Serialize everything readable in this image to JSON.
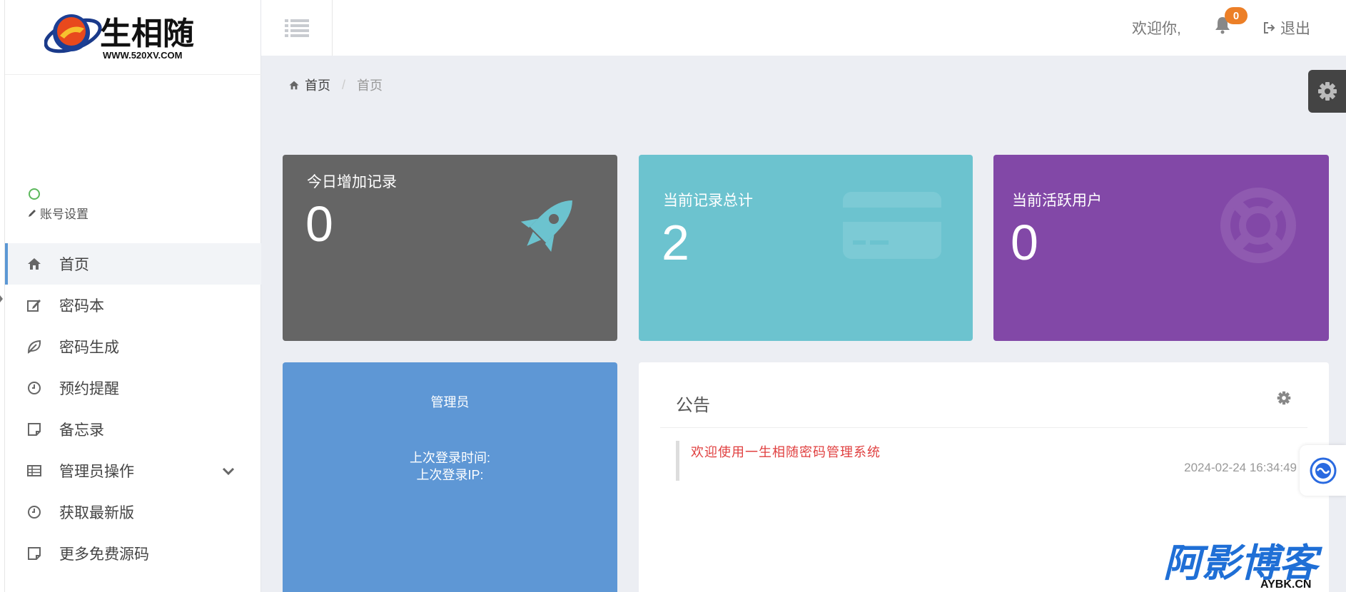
{
  "logo": {
    "text": "生相随",
    "url_text": "WWW.520XV.COM"
  },
  "sidebar": {
    "account_settings": "账号设置",
    "items": [
      {
        "label": "首页",
        "icon": "home-icon",
        "active": true
      },
      {
        "label": "密码本",
        "icon": "edit-icon"
      },
      {
        "label": "密码生成",
        "icon": "leaf-icon"
      },
      {
        "label": "预约提醒",
        "icon": "clock-icon"
      },
      {
        "label": "备忘录",
        "icon": "note-icon"
      },
      {
        "label": "管理员操作",
        "icon": "table-icon",
        "has_submenu": true
      },
      {
        "label": "获取最新版",
        "icon": "clock-icon"
      },
      {
        "label": "更多免费源码",
        "icon": "note-icon"
      }
    ]
  },
  "topbar": {
    "welcome": "欢迎你,",
    "notification_count": "0",
    "logout": "退出"
  },
  "breadcrumb": {
    "home": "首页",
    "current": "首页"
  },
  "stats": {
    "today": {
      "title": "今日增加记录",
      "value": "0"
    },
    "total": {
      "title": "当前记录总计",
      "value": "2"
    },
    "active": {
      "title": "当前活跃用户",
      "value": "0"
    }
  },
  "admin": {
    "name": "管理员",
    "last_login_time": "上次登录时间:",
    "last_login_ip": "上次登录IP:"
  },
  "notice": {
    "title": "公告",
    "items": [
      {
        "text": "欢迎使用一生相随密码管理系统",
        "time": "2024-02-24 16:34:49"
      }
    ]
  },
  "watermark": {
    "text": "阿影博客",
    "sub": "AYBK.CN"
  },
  "colors": {
    "grey_card": "#656565",
    "teal_card": "#6cc3cf",
    "purple_card": "#8248a7",
    "admin_card": "#5e97d5",
    "badge": "#ec7f27",
    "notice_text": "#e04040"
  }
}
